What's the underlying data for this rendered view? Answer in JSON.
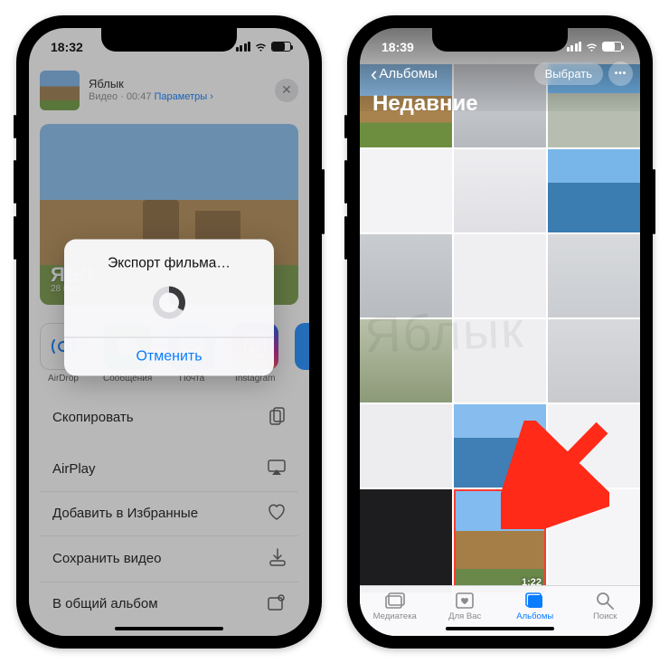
{
  "watermark": "Яблык",
  "left": {
    "status": {
      "time": "18:32"
    },
    "share": {
      "title": "Яблык",
      "type": "Видео",
      "duration": "00:47",
      "params_label": "Параметры",
      "hero_title": "ЯБЛ",
      "hero_date": "28 июня"
    },
    "apps": {
      "airdrop": "AirDrop",
      "messages": "Сообщения",
      "mail": "Почта",
      "instagram": "Instagram"
    },
    "actions": {
      "copy": "Скопировать",
      "airplay": "AirPlay",
      "favorite": "Добавить в Избранные",
      "save": "Сохранить видео",
      "shared_album": "В общий альбом"
    },
    "modal": {
      "title": "Экспорт фильма…",
      "cancel": "Отменить"
    }
  },
  "right": {
    "status": {
      "time": "18:39"
    },
    "nav": {
      "back": "Альбомы",
      "title": "Недавние",
      "select": "Выбрать"
    },
    "video_duration": "1:22",
    "tabs": {
      "library": "Медиатека",
      "for_you": "Для Вас",
      "albums": "Альбомы",
      "search": "Поиск"
    }
  }
}
